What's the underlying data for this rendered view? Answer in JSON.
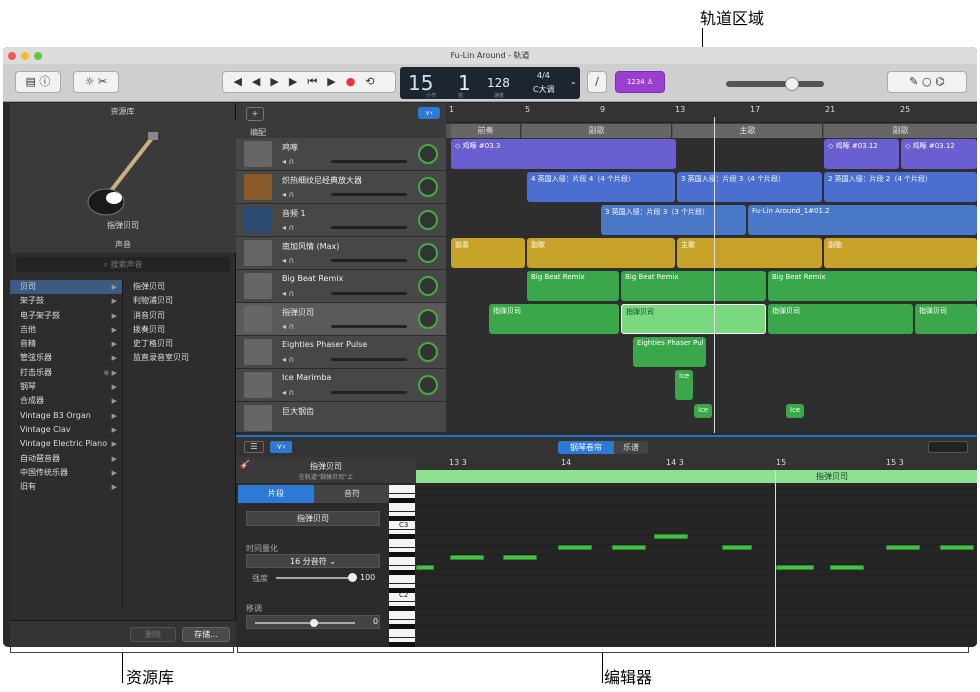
{
  "callouts": {
    "tracks_area": "轨道区域",
    "library": "资源库",
    "editor": "编辑器"
  },
  "window": {
    "title": "Fu-Lin Around - 轨道"
  },
  "lcd": {
    "bar": "15",
    "beat": "1",
    "bar_label": "小节",
    "beat_label": "拍",
    "tempo": "128",
    "tempo_label": "速度",
    "time_sig": "4/4",
    "key": "C大调"
  },
  "toolbar": {
    "count_in": "1234"
  },
  "library": {
    "header": "资源库",
    "instrument_name": "指弹贝司",
    "sounds_header": "声音",
    "search_placeholder": "搜索声音",
    "categories": [
      "贝司",
      "架子鼓",
      "电子架子鼓",
      "吉他",
      "音精",
      "管弦乐器",
      "打击乐器",
      "钢琴",
      "合成器",
      "Vintage B3 Organ",
      "Vintage Clav",
      "Vintage Electric Piano",
      "自动琶音器",
      "中国传统乐器",
      "旧有"
    ],
    "presets": [
      "指弹贝司",
      "利物浦贝司",
      "消音贝司",
      "拨奏贝司",
      "史丁格贝司",
      "监直录音室贝司"
    ],
    "delete_label": "删除",
    "save_label": "存储..."
  },
  "track_area": {
    "add_label": "+",
    "arrange_label": "编配",
    "ruler": [
      "1",
      "5",
      "9",
      "13",
      "17",
      "21",
      "25"
    ],
    "sections": [
      "前奏",
      "副歌",
      "主歌",
      "副歌"
    ],
    "tracks": [
      {
        "name": "鸡啄",
        "color": "#6a5fd0"
      },
      {
        "name": "炽热细纹尼经典放大器",
        "color": "#4a6fd0"
      },
      {
        "name": "音频 1",
        "color": "#4a78c8"
      },
      {
        "name": "南加风情 (Max)",
        "color": "#c8a32a"
      },
      {
        "name": "Big Beat Remix",
        "color": "#3aa84a"
      },
      {
        "name": "指弹贝司",
        "color": "#3aa84a"
      },
      {
        "name": "Eighties Phaser Pulse",
        "color": "#3aa84a"
      },
      {
        "name": "Ice Marimba",
        "color": "#3aa84a"
      },
      {
        "name": "巨大钢齿",
        "color": "#3aa84a"
      }
    ],
    "regions": {
      "r1a": "◇ 鸡啄 #03.3",
      "r1b": "◇ 鸡啄 #03.12",
      "r1c": "◇ 鸡啄 #03.12",
      "r2a": "4 英国入侵：片段 4（4 个片段）",
      "r2b": "3 英国入侵：片段 3（4 个片段）",
      "r2c": "2 英国入侵：片段 2（4 个片段）",
      "r3a": "3 英国入侵：片段 3（3 个片段）",
      "r3b": "Fu-Lin Around_1#01.2",
      "r4a": "前奏",
      "r4b": "副歌",
      "r4c": "主歌",
      "r4d": "副歌",
      "r5a": "Big Beat Remix",
      "r5b": "Big Beat Remix",
      "r5c": "Big Beat Remix",
      "r6a": "指弹贝司",
      "r6b": "指弹贝司",
      "r6c": "指弹贝司",
      "r6d": "指弹贝司",
      "r7a": "Eighties Phaser Pul",
      "r8a": "Ice",
      "r8b": "Ice",
      "r8c": "Ice"
    }
  },
  "editor": {
    "tab_piano_roll": "钢琴卷帘",
    "tab_score": "乐谱",
    "region_name": "指弹贝司",
    "region_sub": "在轨道“指弹贝司”上",
    "tab_region": "片段",
    "tab_notes": "音符",
    "region_field": "指弹贝司",
    "quantize_label": "时间量化",
    "quantize_value": "16 分音符",
    "strength_label": "强度",
    "strength_value": "100",
    "transpose_label": "移调",
    "transpose_value": "0",
    "ruler": [
      "13 3",
      "14",
      "14 3",
      "15",
      "15 3"
    ],
    "region_label": "指弹贝司",
    "c3": "C3",
    "c2": "C2"
  }
}
